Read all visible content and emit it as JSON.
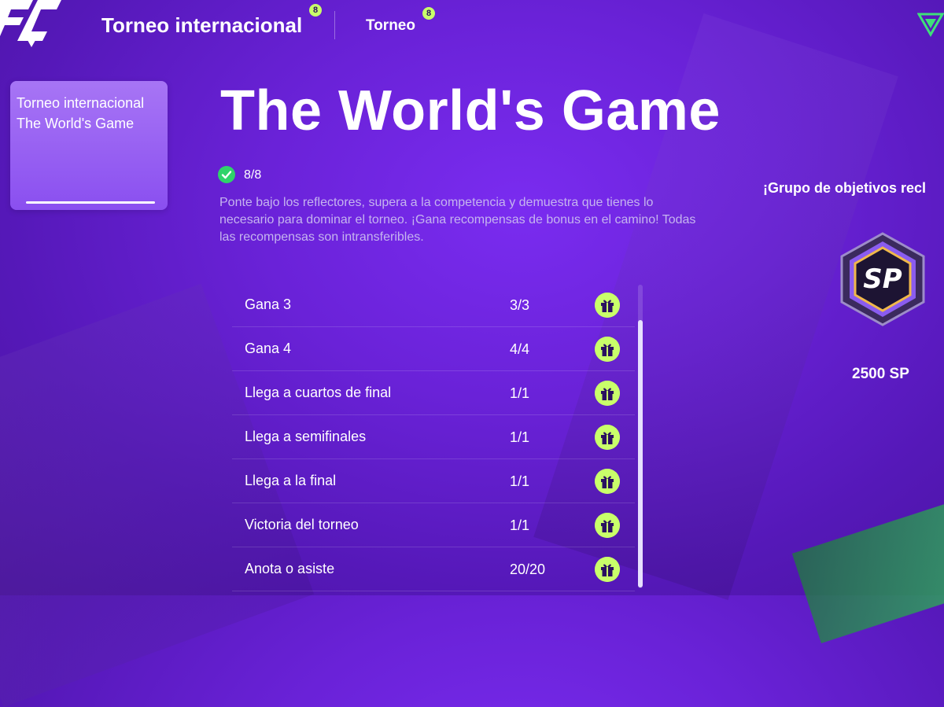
{
  "nav": {
    "logo_icon": "fc-logo-icon",
    "title": "Torneo internacional",
    "title_badge": "8",
    "tab": "Torneo",
    "tab_badge": "8",
    "corner_icon": "triangle-menu-icon"
  },
  "sidebar": {
    "card_title": "Torneo internacional The World's Game"
  },
  "main": {
    "title": "The World's Game",
    "progress_icon": "check-circle-icon",
    "progress": "8/8",
    "description": "Ponte bajo los reflectores, supera a la competencia y demuestra que tienes lo necesario para dominar el torneo. ¡Gana recompensas de bonus en el camino! Todas las recompensas son intransferibles."
  },
  "objectives": [
    {
      "label": "Gana 3",
      "count": "3/3",
      "icon": "gift-icon"
    },
    {
      "label": "Gana 4",
      "count": "4/4",
      "icon": "gift-icon"
    },
    {
      "label": "Llega a cuartos de final",
      "count": "1/1",
      "icon": "gift-icon"
    },
    {
      "label": "Llega a semifinales",
      "count": "1/1",
      "icon": "gift-icon"
    },
    {
      "label": "Llega a la final",
      "count": "1/1",
      "icon": "gift-icon"
    },
    {
      "label": "Victoria del torneo",
      "count": "1/1",
      "icon": "gift-icon"
    },
    {
      "label": "Anota o asiste",
      "count": "20/20",
      "icon": "gift-icon"
    }
  ],
  "reward": {
    "group_title": "¡Grupo de objetivos recl",
    "emblem_text": "SP",
    "value": "2500 SP"
  },
  "colors": {
    "background": "#6a22d8",
    "accent": "#c9ff6a",
    "check": "#2fd36a"
  }
}
